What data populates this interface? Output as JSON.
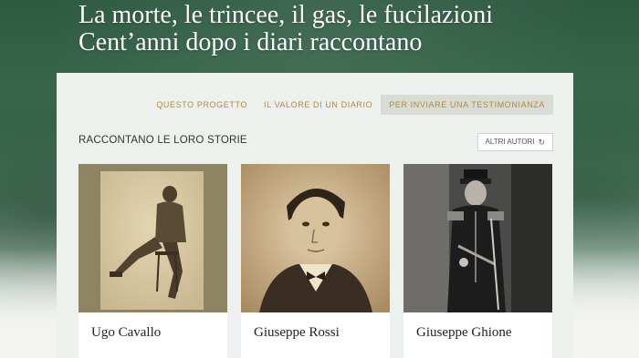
{
  "headline": {
    "line1": "La morte, le trincee, il gas, le fucilazioni",
    "line2": "Cent’anni dopo i diari raccontano"
  },
  "nav": {
    "items": [
      {
        "label": "QUESTO PROGETTO"
      },
      {
        "label": "IL VALORE DI UN DIARIO"
      },
      {
        "label": "PER INVIARE UNA TESTIMONIANZA",
        "active": true
      }
    ]
  },
  "section": {
    "title": "RACCONTANO LE LORO STORIE",
    "more_button": "ALTRI AUTORI",
    "more_icon": "refresh-icon"
  },
  "cards": [
    {
      "name": "Ugo Cavallo",
      "photo": "seated-soldier-photo"
    },
    {
      "name": "Giuseppe Rossi",
      "photo": "young-man-portrait-photo"
    },
    {
      "name": "Giuseppe Ghione",
      "photo": "uniformed-officer-photo"
    }
  ],
  "colors": {
    "accent": "#b0893d",
    "background_green": "#2f5a42",
    "panel": "#edf1ee"
  }
}
